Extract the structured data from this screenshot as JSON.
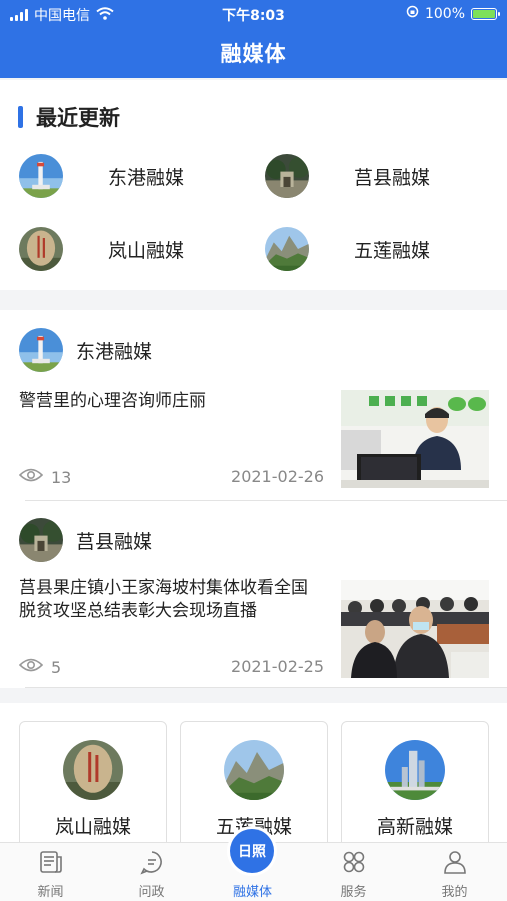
{
  "status": {
    "carrier": "中国电信",
    "time": "下午8:03",
    "battery": "100%"
  },
  "nav": {
    "title": "融媒体"
  },
  "recent": {
    "title": "最近更新",
    "items": [
      {
        "name": "东港融媒"
      },
      {
        "name": "莒县融媒"
      },
      {
        "name": "岚山融媒"
      },
      {
        "name": "五莲融媒"
      }
    ]
  },
  "articles": [
    {
      "source": "东港融媒",
      "title": "警营里的心理咨询师庄丽",
      "views": "13",
      "date": "2021-02-26"
    },
    {
      "source": "莒县融媒",
      "title": "莒县果庄镇小王家海坡村集体收看全国脱贫攻坚总结表彰大会现场直播",
      "views": "5",
      "date": "2021-02-25"
    }
  ],
  "cards": [
    {
      "name": "岚山融媒"
    },
    {
      "name": "五莲融媒"
    },
    {
      "name": "高新融媒"
    }
  ],
  "tabs": [
    {
      "label": "新闻",
      "icon": "newspaper-icon"
    },
    {
      "label": "问政",
      "icon": "chat-icon"
    },
    {
      "label": "融媒体",
      "icon": "sun-badge-icon",
      "badge": "日照"
    },
    {
      "label": "服务",
      "icon": "grid-icon"
    },
    {
      "label": "我的",
      "icon": "user-icon"
    }
  ],
  "colors": {
    "primary": "#2f72e5",
    "battery_fill": "#7ee05a"
  }
}
